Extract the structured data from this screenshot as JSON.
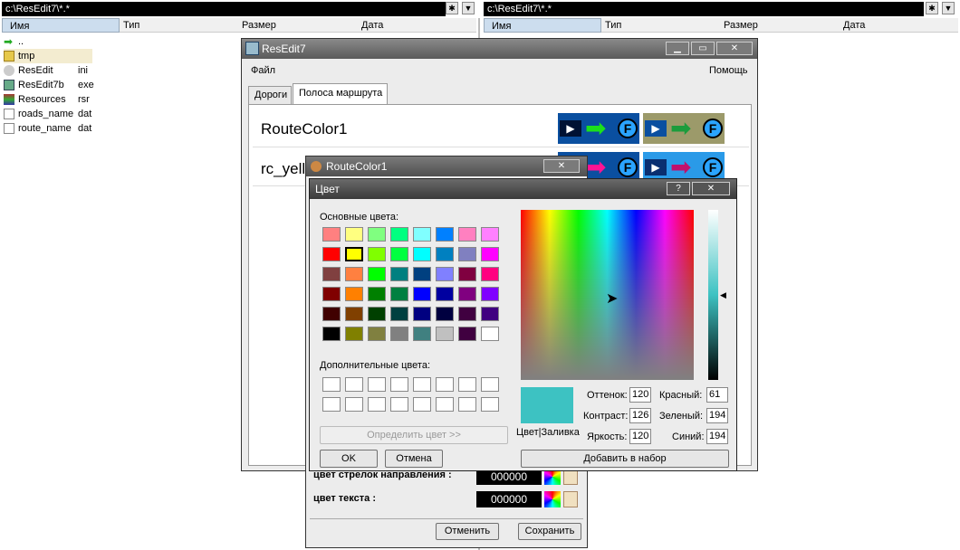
{
  "left_panel": {
    "path": "c:\\ResEdit7\\*.*",
    "columns": [
      "Имя",
      "Тип",
      "Размер",
      "Дата"
    ],
    "files": [
      {
        "name": "..",
        "ext": ""
      },
      {
        "name": "tmp",
        "ext": ""
      },
      {
        "name": "ResEdit",
        "ext": "ini"
      },
      {
        "name": "ResEdit7b",
        "ext": "exe"
      },
      {
        "name": "Resources",
        "ext": "rsr"
      },
      {
        "name": "roads_name",
        "ext": "dat"
      },
      {
        "name": "route_name",
        "ext": "dat"
      }
    ]
  },
  "right_panel": {
    "path": "c:\\ResEdit7\\*.*",
    "columns": [
      "Имя",
      "Тип",
      "Размер",
      "Дата"
    ]
  },
  "resedit": {
    "title": "ResEdit7",
    "menu_file": "Файл",
    "menu_help": "Помощь",
    "tab_roads": "Дороги",
    "tab_route": "Полоса маршрута",
    "row1": "RouteColor1",
    "row2": "rc_yell"
  },
  "routecolor": {
    "title": "RouteColor1",
    "arrow_label": "цвет стрелок направления :",
    "arrow_value": "000000",
    "text_label": "цвет текста :",
    "text_value": "000000",
    "cancel": "Отменить",
    "save": "Сохранить"
  },
  "color_dialog": {
    "title": "Цвет",
    "help": "?",
    "close": "✕",
    "basic_label": "Основные цвета:",
    "custom_label": "Дополнительные цвета:",
    "define": "Определить цвет >>",
    "ok": "OK",
    "cancel": "Отмена",
    "add": "Добавить в набор",
    "solid_label": "Цвет|Заливка",
    "hue_label": "Оттенок:",
    "hue": "120",
    "sat_label": "Контраст:",
    "sat": "126",
    "lum_label": "Яркость:",
    "lum": "120",
    "red_label": "Красный:",
    "red": "61",
    "green_label": "Зеленый:",
    "green": "194",
    "blue_label": "Синий:",
    "blue": "194",
    "selected_color": "#3dc2c2",
    "basic_colors": [
      "#ff8080",
      "#ffff80",
      "#80ff80",
      "#00ff80",
      "#80ffff",
      "#0080ff",
      "#ff80c0",
      "#ff80ff",
      "#ff0000",
      "#ffff00",
      "#80ff00",
      "#00ff40",
      "#00ffff",
      "#0080c0",
      "#8080c0",
      "#ff00ff",
      "#804040",
      "#ff8040",
      "#00ff00",
      "#008080",
      "#004080",
      "#8080ff",
      "#800040",
      "#ff0080",
      "#800000",
      "#ff8000",
      "#008000",
      "#008040",
      "#0000ff",
      "#0000a0",
      "#800080",
      "#8000ff",
      "#400000",
      "#804000",
      "#004000",
      "#004040",
      "#000080",
      "#000040",
      "#400040",
      "#400080",
      "#000000",
      "#808000",
      "#808040",
      "#808080",
      "#408080",
      "#c0c0c0",
      "#400040",
      "#ffffff"
    ]
  }
}
